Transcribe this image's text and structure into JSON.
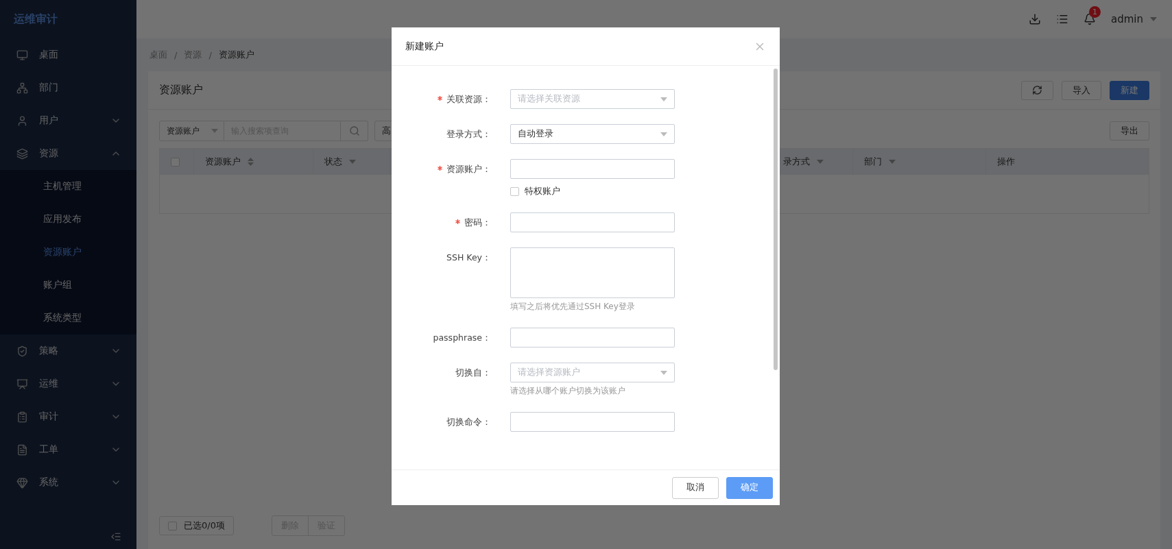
{
  "sidebar": {
    "logo": "运维审计",
    "items": [
      {
        "label": "桌面"
      },
      {
        "label": "部门"
      },
      {
        "label": "用户",
        "expanded": false
      },
      {
        "label": "资源",
        "expanded": true,
        "children": [
          {
            "label": "主机管理",
            "selected": false
          },
          {
            "label": "应用发布",
            "selected": false
          },
          {
            "label": "资源账户",
            "selected": true
          },
          {
            "label": "账户组",
            "selected": false
          },
          {
            "label": "系统类型",
            "selected": false
          }
        ]
      },
      {
        "label": "策略",
        "expanded": false
      },
      {
        "label": "运维",
        "expanded": false
      },
      {
        "label": "审计",
        "expanded": false
      },
      {
        "label": "工单",
        "expanded": false
      },
      {
        "label": "系统",
        "expanded": false
      }
    ]
  },
  "header": {
    "notification_count": "1",
    "user": "admin"
  },
  "breadcrumb": {
    "separator": "/",
    "items": [
      "桌面",
      "资源",
      "资源账户"
    ]
  },
  "card": {
    "title": "资源账户",
    "actions": [
      {
        "kind": "icon"
      },
      {
        "kind": "default",
        "label": "导入"
      },
      {
        "kind": "primary",
        "label": "新建"
      }
    ],
    "search": {
      "field": "资源账户",
      "placeholder": "输入搜索项查询",
      "advanced": "高"
    },
    "export": "导出",
    "table": {
      "select_all_checked": false,
      "columns": [
        {
          "label": "资源账户",
          "kind": "sort"
        },
        {
          "label": "状态",
          "kind": "filter"
        },
        {
          "label": "录方式",
          "kind": "filter"
        },
        {
          "label": "部门",
          "kind": "filter"
        },
        {
          "label": "操作",
          "kind": "plain"
        }
      ]
    },
    "footer": {
      "selection": "已选0/0项",
      "checked": false,
      "buttons": [
        {
          "label": "删除",
          "disabled": true
        },
        {
          "label": "验证",
          "disabled": true
        }
      ]
    }
  },
  "modal": {
    "title": "新建账户",
    "fields": [
      {
        "kind": "select",
        "label": "关联资源：",
        "required": true,
        "placeholder": "请选择关联资源"
      },
      {
        "kind": "select",
        "label": "登录方式：",
        "required": false,
        "value": "自动登录"
      },
      {
        "kind": "input",
        "label": "资源账户：",
        "required": true,
        "checkbox": {
          "label": "特权账户",
          "checked": false
        }
      },
      {
        "kind": "input",
        "label": "密码：",
        "required": true
      },
      {
        "kind": "textarea",
        "label": "SSH Key：",
        "required": false,
        "hint": "填写之后将优先通过SSH Key登录"
      },
      {
        "kind": "input",
        "label": "passphrase：",
        "required": false
      },
      {
        "kind": "select",
        "label": "切换自：",
        "required": false,
        "placeholder": "请选择资源账户",
        "hint": "请选择从哪个账户切换为该账户"
      },
      {
        "kind": "input",
        "label": "切换命令：",
        "required": false
      }
    ],
    "buttons": [
      {
        "kind": "default",
        "label": "取消"
      },
      {
        "kind": "primary",
        "label": "确定"
      }
    ]
  }
}
